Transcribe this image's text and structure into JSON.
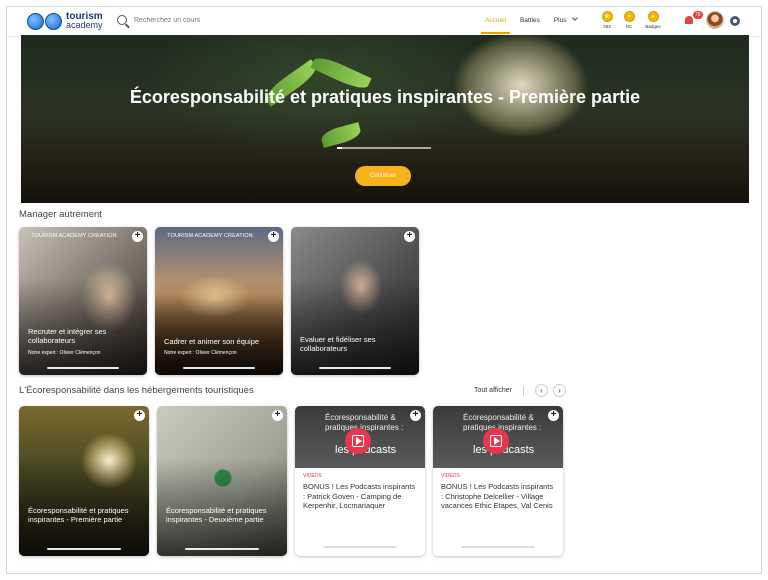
{
  "logo": {
    "line1": "tourism",
    "line2": "academy"
  },
  "search": {
    "placeholder": "Recherchez un cours"
  },
  "nav": {
    "home": "Accueil",
    "battles": "Battles",
    "more": "Plus"
  },
  "stats": [
    {
      "value": "283",
      "label": "283"
    },
    {
      "value": "NC",
      "label": "NC"
    },
    {
      "value": "Badges",
      "label": "Badges"
    }
  ],
  "notifications": {
    "count": "76"
  },
  "hero": {
    "title": "Écoresponsabilité et pratiques inspirantes - Première partie",
    "button": "Continuer",
    "progress": 0.05
  },
  "section1": {
    "title": "Manager autrement",
    "cards": [
      {
        "ribbon": "TOURISM ACADEMY CREATION",
        "title": "Recruter et intégrer ses collaborateurs",
        "expert": "Notre expert : Olivier Clémençon"
      },
      {
        "ribbon": "TOURISM ACADEMY CREATION",
        "title": "Cadrer et animer son équipe",
        "expert": "Notre expert : Olivier Clémençon"
      },
      {
        "ribbon": "",
        "title": "Evaluer et fidéliser ses collaborateurs",
        "expert": ""
      }
    ]
  },
  "section2": {
    "title": "L'Écoresponsabilité dans les hébergements touristiques",
    "see_all": "Tout afficher",
    "cards": [
      {
        "title": "Écoresponsabilité et pratiques inspirantes - Première partie"
      },
      {
        "title": "Écoresponsabilité et pratiques inspirantes - Deuxième partie"
      },
      {
        "tag": "VIDÉOS",
        "thumb_text": "Écoresponsabilité & pratiques inspirantes :",
        "thumb_big": "les podcasts",
        "title": "BONUS ! Les Podcasts inspirants : Patrick Goven - Camping de Kerpenhir, Locmariaquer"
      },
      {
        "tag": "VIDÉOS",
        "thumb_text": "Écoresponsabilité & pratiques inspirantes :",
        "thumb_big": "les podcasts",
        "title": "BONUS ! Les Podcasts inspirants : Christophe Delcellier - Village vacances Ethic Etapes, Val Cenis"
      }
    ]
  },
  "colors": {
    "accent": "#f5b21b",
    "nav_active": "#f0a000",
    "video_tag": "#e0394a",
    "notif": "#e04545"
  }
}
